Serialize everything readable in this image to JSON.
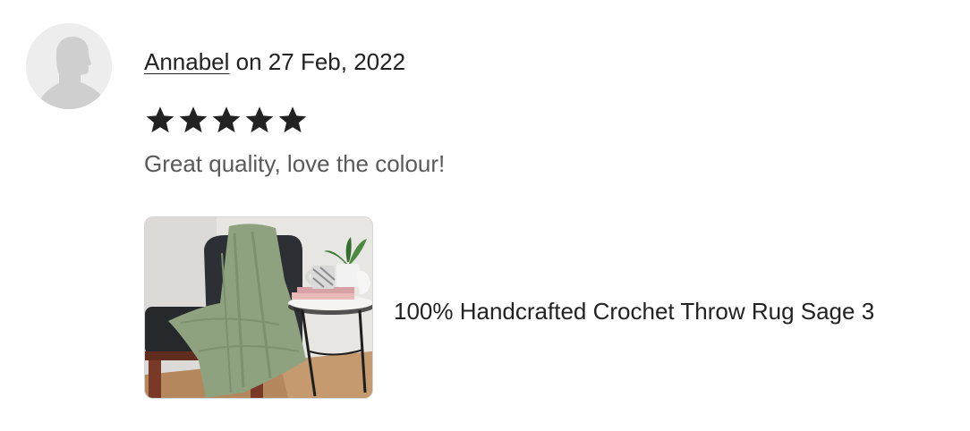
{
  "review": {
    "reviewer_name": "Annabel",
    "date_text": "on 27 Feb, 2022",
    "rating": 5,
    "rating_max": 5,
    "text": "Great quality, love the colour!"
  },
  "item": {
    "title": "100% Handcrafted Crochet Throw Rug Sage 3"
  },
  "icons": {
    "avatar": "person-silhouette-icon",
    "star": "star-filled-icon"
  },
  "colors": {
    "star": "#222222",
    "text_primary": "#222222",
    "text_secondary": "#595959",
    "avatar_bg": "#ededed",
    "avatar_figure": "#cfcfcf"
  }
}
